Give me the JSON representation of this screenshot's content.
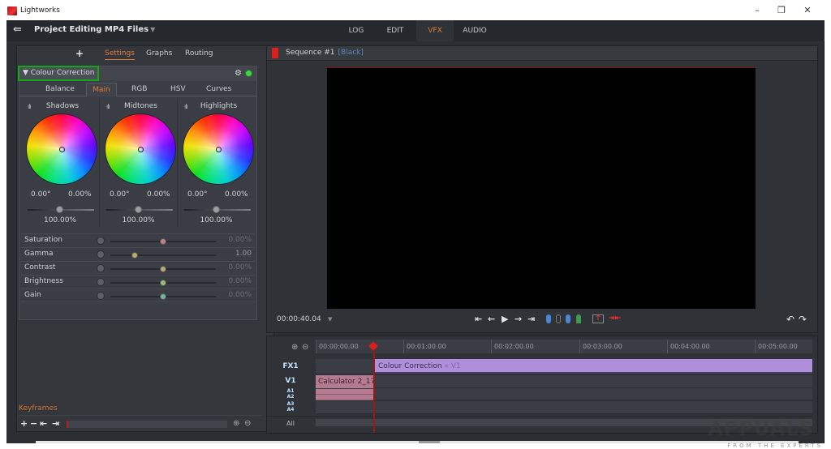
{
  "window": {
    "title": "Lightworks",
    "controls": [
      "minimize",
      "restore",
      "close"
    ]
  },
  "topbar": {
    "project_title": "Project Editing MP4 Files",
    "tabs": [
      {
        "label": "LOG",
        "active": false
      },
      {
        "label": "EDIT",
        "active": false
      },
      {
        "label": "VFX",
        "active": true
      },
      {
        "label": "AUDIO",
        "active": false
      }
    ]
  },
  "left_panel": {
    "add_label": "+",
    "tabs": [
      {
        "label": "Settings",
        "active": true
      },
      {
        "label": "Graphs",
        "active": false
      },
      {
        "label": "Routing",
        "active": false
      }
    ],
    "effect": {
      "title": "Colour Correction",
      "enabled": true,
      "subtabs": [
        {
          "label": "Balance",
          "active": false
        },
        {
          "label": "Main",
          "active": true
        },
        {
          "label": "RGB",
          "active": false
        },
        {
          "label": "HSV",
          "active": false
        },
        {
          "label": "Curves",
          "active": false
        }
      ],
      "wheels": [
        {
          "label": "Shadows",
          "hue": "0.00°",
          "sat": "0.00%",
          "level": "100.00%"
        },
        {
          "label": "Midtones",
          "hue": "0.00°",
          "sat": "0.00%",
          "level": "100.00%"
        },
        {
          "label": "Highlights",
          "hue": "0.00°",
          "sat": "0.00%",
          "level": "100.00%"
        }
      ],
      "adjustments": [
        {
          "label": "Saturation",
          "value": "0.00%",
          "position": 0.5,
          "color": "#c77f86"
        },
        {
          "label": "Gamma",
          "value": "1.00",
          "position": 0.23,
          "color": "#b9ab72"
        },
        {
          "label": "Contrast",
          "value": "0.00%",
          "position": 0.5,
          "color": "#b9ab72"
        },
        {
          "label": "Brightness",
          "value": "0.00%",
          "position": 0.5,
          "color": "#9bbf7c"
        },
        {
          "label": "Gain",
          "value": "0.00%",
          "position": 0.5,
          "color": "#6fb8a0"
        }
      ]
    },
    "keyframes": {
      "label": "Keyframes",
      "buttons": [
        "+",
        "−",
        "⇤",
        "⇥"
      ]
    }
  },
  "viewer": {
    "sequence_title": "Sequence #1",
    "sequence_tag": "[Black]",
    "timecode": "00:00:40.04"
  },
  "timeline": {
    "ruler_labels": [
      "00:00:00.00",
      "00:01:00.00",
      "00:02:00.00",
      "00:03:00.00",
      "00:04:00.00",
      "00:05:00.00"
    ],
    "tracks": [
      "FX1",
      "V1",
      "A1",
      "A2",
      "A3",
      "A4"
    ],
    "all_label": "All",
    "fx_clip": {
      "label": "Colour Correction",
      "source": "« V1"
    },
    "v1_clip": {
      "label": "Calculator 2_17"
    }
  },
  "watermark": {
    "text": "APPUALS",
    "sub": "FROM THE EXPERTS"
  },
  "colors": {
    "accent": "#e07b35",
    "playhead": "#e01d1d",
    "fx_clip": "#ae8fd9",
    "v1_clip": "#b47b90",
    "enabled_led": "#3fd33f",
    "highlight_box": "#17a31a"
  }
}
